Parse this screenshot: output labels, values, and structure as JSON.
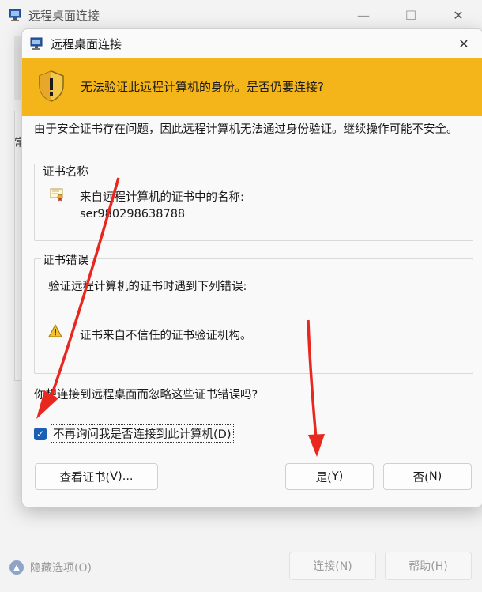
{
  "background_window": {
    "title": "远程桌面连接",
    "tab_fragment": "常",
    "hide_options": "隐藏选项(O)",
    "connect_button": "连接(N)",
    "help_button": "帮助(H)"
  },
  "dialog": {
    "title": "远程桌面连接",
    "banner_text": "无法验证此远程计算机的身份。是否仍要连接?",
    "description": "由于安全证书存在问题，因此远程计算机无法通过身份验证。继续操作可能不安全。",
    "cert_name_group": {
      "legend": "证书名称",
      "label": "来自远程计算机的证书中的名称:",
      "value": "ser980298638788"
    },
    "cert_error_group": {
      "legend": "证书错误",
      "description": "验证远程计算机的证书时遇到下列错误:",
      "error_item": "证书来自不信任的证书验证机构。"
    },
    "question": "你想连接到远程桌面而忽略这些证书错误吗?",
    "checkbox": {
      "label_prefix": "不再询问我是否连接到此计算机(",
      "label_key": "D",
      "label_suffix": ")",
      "checked": true
    },
    "buttons": {
      "view_cert_prefix": "查看证书(",
      "view_cert_key": "V",
      "view_cert_suffix": ")...",
      "yes_prefix": "是(",
      "yes_key": "Y",
      "yes_suffix": ")",
      "no_prefix": "否(",
      "no_key": "N",
      "no_suffix": ")"
    }
  },
  "colors": {
    "banner": "#f4b51a",
    "checkbox": "#1a5fb4",
    "annotation_arrow": "#e8271f"
  }
}
